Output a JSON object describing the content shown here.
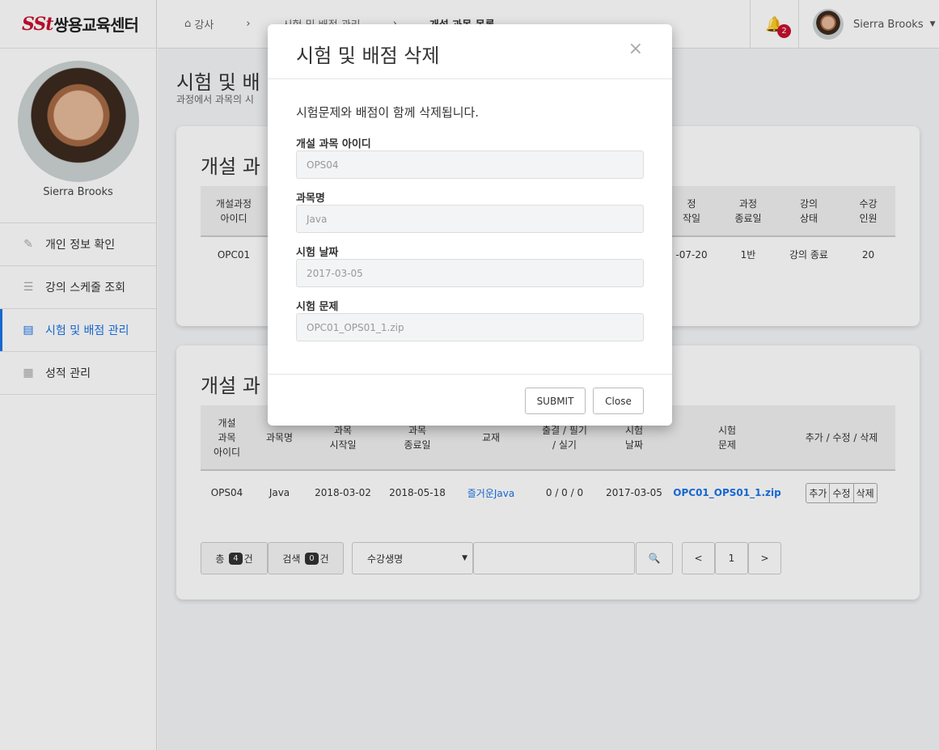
{
  "brand": {
    "mark": "SSt",
    "name": "쌍용교육센터"
  },
  "profile": {
    "name": "Sierra Brooks"
  },
  "menu": [
    {
      "label": "개인 정보 확인",
      "icon": "pencil-icon"
    },
    {
      "label": "강의 스케줄 조회",
      "icon": "list-icon"
    },
    {
      "label": "시험 및 배점 관리",
      "icon": "file-plus-icon",
      "active": true
    },
    {
      "label": "성적 관리",
      "icon": "grid-icon"
    }
  ],
  "breadcrumb": {
    "home": "강사",
    "b1": "시험 및 배점 관리",
    "b2": "개설 과목 목록"
  },
  "topbar": {
    "notif_count": "2",
    "user": "Sierra Brooks"
  },
  "page": {
    "title": "시험 및 배",
    "subtitle": "과정에서 과목의 시"
  },
  "card1": {
    "title": "개설 과",
    "headers": [
      "개설과정\n아이디",
      "",
      "",
      "",
      "과정\n작일",
      "과정\n종료일",
      "강의\n상태",
      "수강\n인원"
    ],
    "row": {
      "id": "OPC01",
      "end": "-07-20",
      "room": "1반",
      "status": "강의 종료",
      "count": "20"
    }
  },
  "card2": {
    "title": "개설 과",
    "headers": [
      "개설\n과목\n아이디",
      "과목명",
      "과목\n시작일",
      "과목\n종료일",
      "교재",
      "출결 / 필기\n/ 실기",
      "시험\n날짜",
      "시험\n문제",
      "추가 / 수정 / 삭제"
    ],
    "row": {
      "id": "OPS04",
      "name": "Java",
      "start": "2018-03-02",
      "end": "2018-05-18",
      "book": "즐거운Java",
      "score": "0 / 0 / 0",
      "date": "2017-03-05",
      "file": "OPC01_OPS01_1.zip",
      "add": "추가",
      "edit": "수정",
      "del": "삭제"
    }
  },
  "pager": {
    "total_pre": "총",
    "total": "4",
    "total_suf": "건",
    "search_pre": "검색",
    "search": "0",
    "search_suf": "건",
    "select": "수강생명",
    "prev": "<",
    "page": "1",
    "next": ">"
  },
  "modal": {
    "title": "시험 및 배점 삭제",
    "note": "시험문제와 배점이 함께 삭제됩니다.",
    "fields": [
      {
        "label": "개설 과목 아이디",
        "value": "OPS04"
      },
      {
        "label": "과목명",
        "value": "Java"
      },
      {
        "label": "시험 날짜",
        "value": "2017-03-05"
      },
      {
        "label": "시험 문제",
        "value": "OPC01_OPS01_1.zip"
      }
    ],
    "submit": "SUBMIT",
    "close": "Close"
  }
}
